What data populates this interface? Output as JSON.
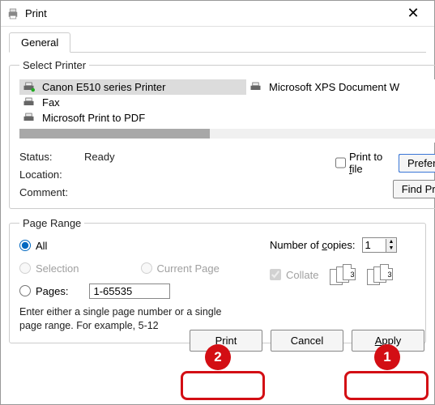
{
  "window": {
    "title": "Print"
  },
  "tabs": {
    "general": "General"
  },
  "select_printer": {
    "legend": "Select Printer",
    "items": [
      {
        "name": "Canon E510 series Printer",
        "selected": true
      },
      {
        "name": "Microsoft XPS Document W",
        "selected": false
      },
      {
        "name": "Fax",
        "selected": false
      },
      {
        "name": "Microsoft Print to PDF",
        "selected": false
      }
    ],
    "status_label": "Status:",
    "status_value": "Ready",
    "location_label": "Location:",
    "location_value": "",
    "comment_label": "Comment:",
    "comment_value": "",
    "print_to_file": "Print to file",
    "preferences": "Preferences",
    "find_printer": "Find Printer..."
  },
  "page_range": {
    "legend": "Page Range",
    "all": "All",
    "selection": "Selection",
    "current_page": "Current Page",
    "pages_label": "Pages:",
    "pages_value": "1-65535",
    "hint": "Enter either a single page number or a single page range.  For example, 5-12",
    "copies_label": "Number of copies:",
    "copies_value": "1",
    "collate": "Collate"
  },
  "footer": {
    "print": "Print",
    "cancel": "Cancel",
    "apply": "Apply"
  },
  "annotations": {
    "one": "1",
    "two": "2"
  }
}
